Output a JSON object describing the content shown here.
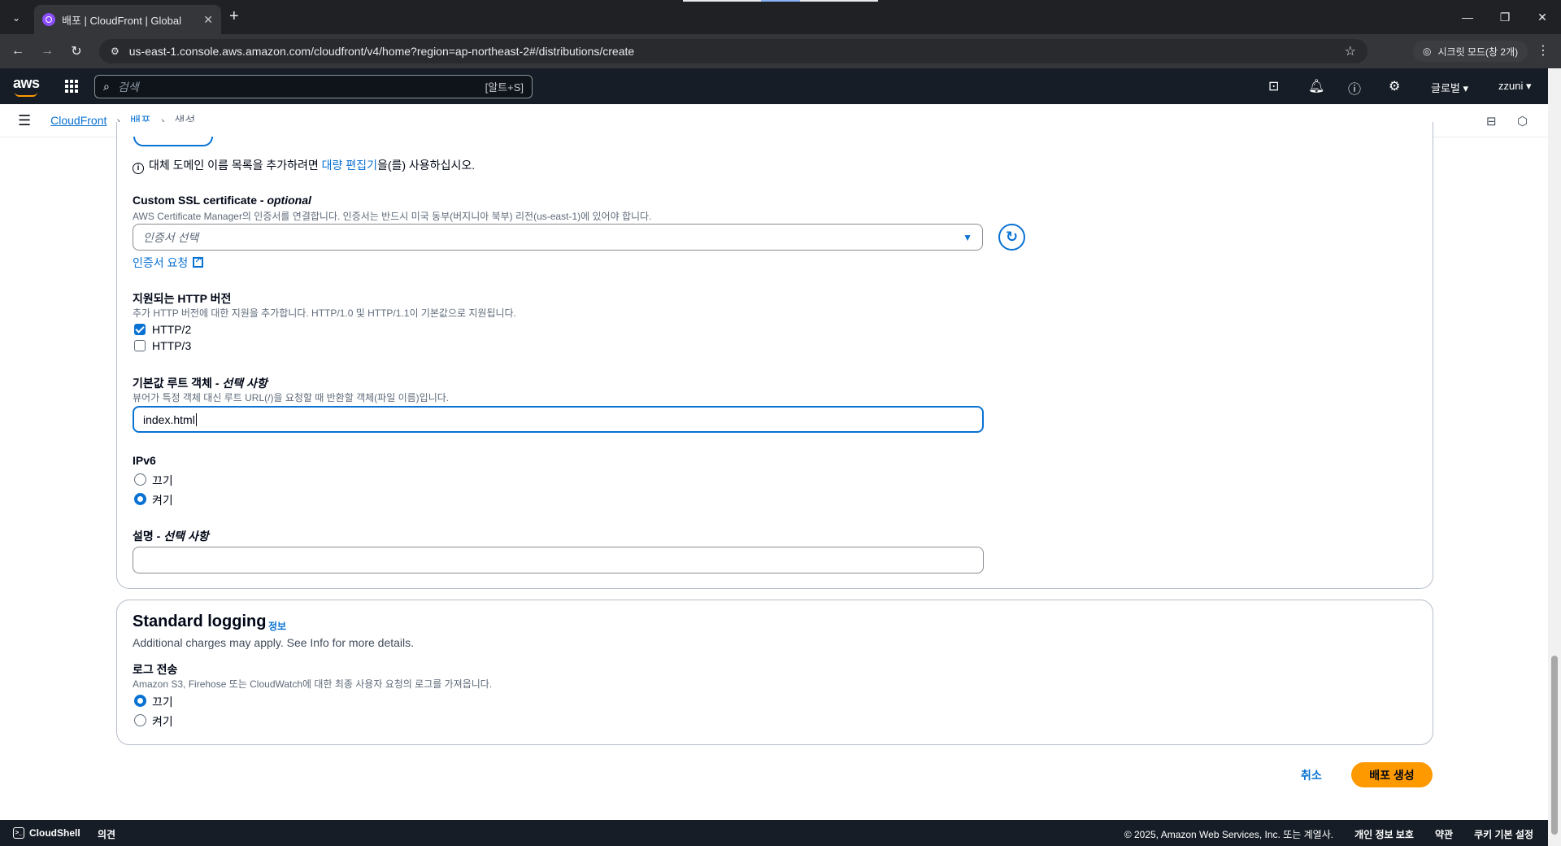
{
  "browser": {
    "tab_title": "배포 | CloudFront | Global",
    "tab_close": "✕",
    "new_tab": "+",
    "url": "us-east-1.console.aws.amazon.com/cloudfront/v4/home?region=ap-northeast-2#/distributions/create",
    "incognito_label": "시크릿 모드(창 2개)"
  },
  "aws_header": {
    "logo_text": "aws",
    "search_placeholder": "검색",
    "search_shortcut": "[알트+S]",
    "region": "글로벌 ▾",
    "user": "zzuni ▾"
  },
  "breadcrumb": {
    "items": [
      "CloudFront",
      "배포"
    ],
    "current": "생성"
  },
  "form": {
    "alt_domain_info_prefix": "대체 도메인 이름 목록을 추가하려면 ",
    "alt_domain_info_link": "대량 편집기",
    "alt_domain_info_suffix": "을(를) 사용하십시오.",
    "ssl": {
      "label": "Custom SSL certificate - ",
      "label_optional": "optional",
      "description": "AWS Certificate Manager의 인증서를 연결합니다. 인증서는 반드시 미국 동부(버지니아 북부) 리전(us-east-1)에 있어야 합니다.",
      "placeholder": "인증서 선택",
      "request_link": "인증서 요청"
    },
    "http_versions": {
      "label": "지원되는 HTTP 버전",
      "description": "추가 HTTP 버전에 대한 지원을 추가합니다. HTTP/1.0 및 HTTP/1.1이 기본값으로 지원됩니다.",
      "options": [
        {
          "label": "HTTP/2",
          "checked": true
        },
        {
          "label": "HTTP/3",
          "checked": false
        }
      ]
    },
    "root_object": {
      "label": "기본값 루트 객체 - ",
      "label_optional": "선택 사항",
      "description": "뷰어가 특정 객체 대신 루트 URL(/)을 요청할 때 반환할 객체(파일 이름)입니다.",
      "value": "index.html"
    },
    "ipv6": {
      "label": "IPv6",
      "options": [
        {
          "label": "끄기",
          "selected": false
        },
        {
          "label": "켜기",
          "selected": true
        }
      ]
    },
    "description_field": {
      "label": "설명 - ",
      "label_optional": "선택 사항",
      "value": ""
    }
  },
  "logging": {
    "title": "Standard logging",
    "info": "정보",
    "description": "Additional charges may apply. See Info for more details.",
    "delivery_label": "로그 전송",
    "delivery_description": "Amazon S3, Firehose 또는 CloudWatch에 대한 최종 사용자 요청의 로그를 가져옵니다.",
    "options": [
      {
        "label": "끄기",
        "selected": true
      },
      {
        "label": "켜기",
        "selected": false
      }
    ]
  },
  "actions": {
    "cancel": "취소",
    "create": "배포 생성"
  },
  "footer": {
    "cloudshell": "CloudShell",
    "feedback": "의견",
    "copyright": "© 2025, Amazon Web Services, Inc. 또는 계열사.",
    "privacy": "개인 정보 보호",
    "terms": "약관",
    "cookies": "쿠키 기본 설정"
  },
  "colors": {
    "accent": "#0972d3",
    "primary_button": "#ff9900",
    "header_bg": "#161d26"
  }
}
